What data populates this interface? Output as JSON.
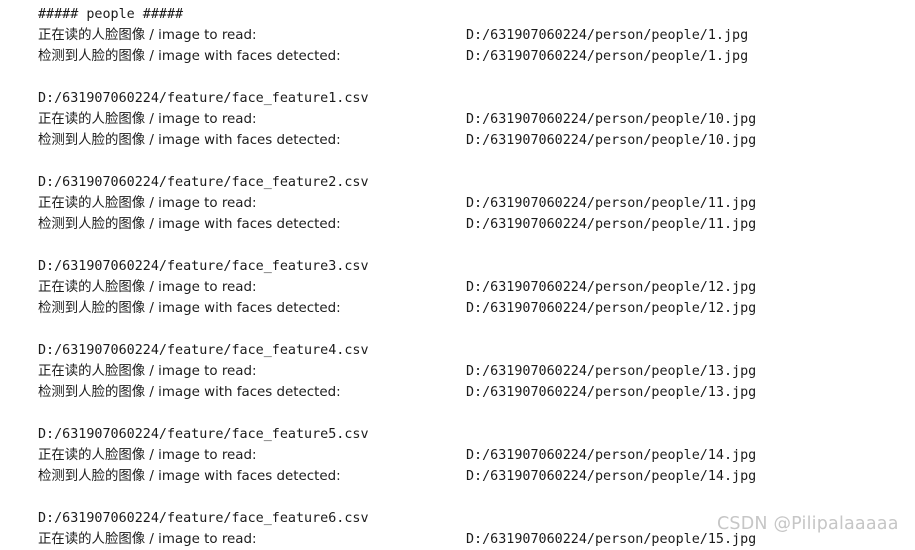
{
  "console": {
    "header": "##### people #####",
    "labels": {
      "reading": "正在读的人脸图像 / image to read:",
      "detected": "检测到人脸的图像 / image with faces detected:"
    },
    "blocks": [
      {
        "csv_path": "",
        "reading_label": "正在读的人脸图像 / image to read:",
        "reading_path": "D:/631907060224/person/people/1.jpg",
        "detected_label": "检测到人脸的图像 / image with faces detected:",
        "detected_path": "D:/631907060224/person/people/1.jpg"
      },
      {
        "csv_path": "D:/631907060224/feature/face_feature1.csv",
        "reading_label": "正在读的人脸图像 / image to read:",
        "reading_path": "D:/631907060224/person/people/10.jpg",
        "detected_label": "检测到人脸的图像 / image with faces detected:",
        "detected_path": "D:/631907060224/person/people/10.jpg"
      },
      {
        "csv_path": "D:/631907060224/feature/face_feature2.csv",
        "reading_label": "正在读的人脸图像 / image to read:",
        "reading_path": "D:/631907060224/person/people/11.jpg",
        "detected_label": "检测到人脸的图像 / image with faces detected:",
        "detected_path": "D:/631907060224/person/people/11.jpg"
      },
      {
        "csv_path": "D:/631907060224/feature/face_feature3.csv",
        "reading_label": "正在读的人脸图像 / image to read:",
        "reading_path": "D:/631907060224/person/people/12.jpg",
        "detected_label": "检测到人脸的图像 / image with faces detected:",
        "detected_path": "D:/631907060224/person/people/12.jpg"
      },
      {
        "csv_path": "D:/631907060224/feature/face_feature4.csv",
        "reading_label": "正在读的人脸图像 / image to read:",
        "reading_path": "D:/631907060224/person/people/13.jpg",
        "detected_label": "检测到人脸的图像 / image with faces detected:",
        "detected_path": "D:/631907060224/person/people/13.jpg"
      },
      {
        "csv_path": "D:/631907060224/feature/face_feature5.csv",
        "reading_label": "正在读的人脸图像 / image to read:",
        "reading_path": "D:/631907060224/person/people/14.jpg",
        "detected_label": "检测到人脸的图像 / image with faces detected:",
        "detected_path": "D:/631907060224/person/people/14.jpg"
      },
      {
        "csv_path": "D:/631907060224/feature/face_feature6.csv",
        "reading_label": "正在读的人脸图像 / image to read:",
        "reading_path": "D:/631907060224/person/people/15.jpg",
        "detected_label": "",
        "detected_path": ""
      }
    ]
  },
  "watermark": {
    "text": "CSDN @Pilipalaaaaa",
    "color": "#c6c6c6"
  },
  "colors": {
    "background": "#ffffff",
    "text": "#1b1b1b",
    "watermark": "#c6c6c6"
  }
}
